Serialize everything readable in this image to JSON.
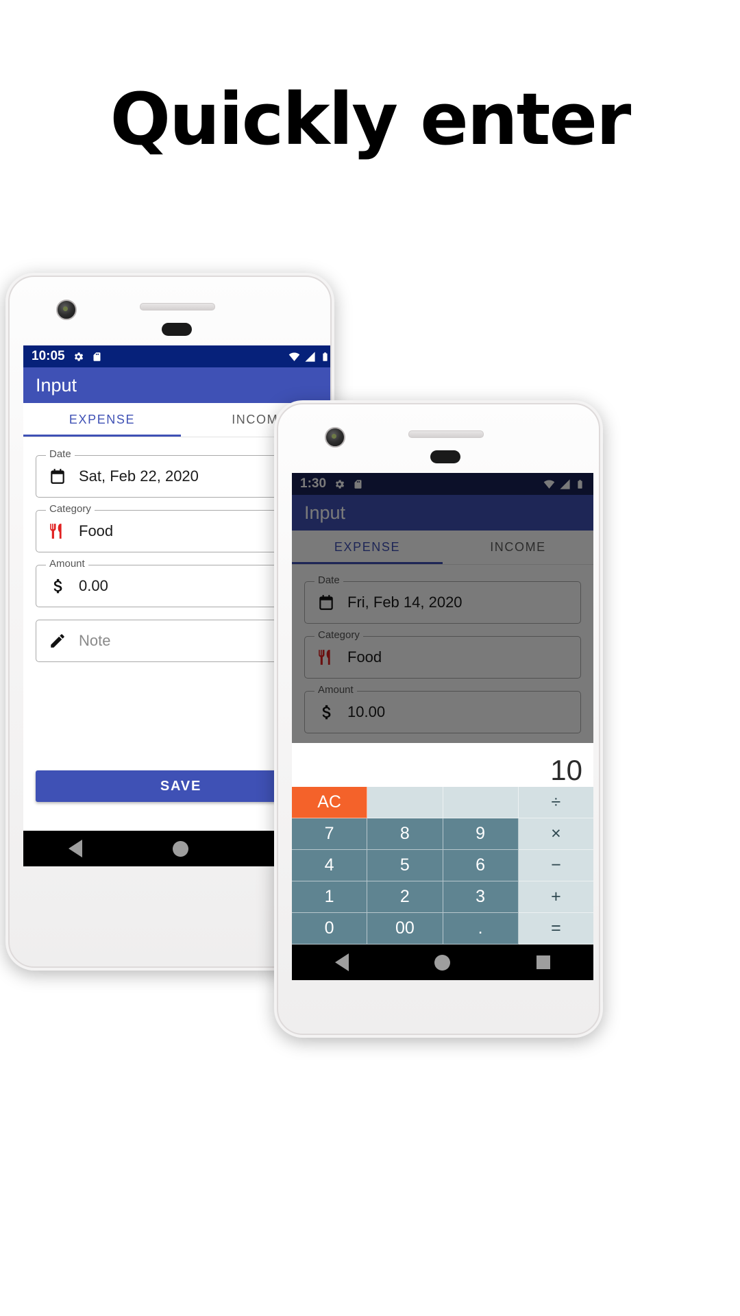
{
  "headline": "Quickly enter",
  "phone1": {
    "statusbar": {
      "time": "10:05",
      "icons": [
        "gear-icon",
        "sdcard-icon"
      ],
      "right_icons": [
        "wifi-icon",
        "signal-icon",
        "battery-icon"
      ]
    },
    "appbar": {
      "title": "Input"
    },
    "tabs": [
      {
        "label": "EXPENSE",
        "active": true
      },
      {
        "label": "INCOME",
        "active": false
      }
    ],
    "fields": [
      {
        "label": "Date",
        "value": "Sat, Feb 22, 2020",
        "icon": "calendar-icon",
        "placeholder": false
      },
      {
        "label": "Category",
        "value": "Food",
        "icon": "restaurant-icon",
        "placeholder": false
      },
      {
        "label": "Amount",
        "value": "0.00",
        "icon": "dollar-icon",
        "placeholder": false
      },
      {
        "label": "",
        "value": "Note",
        "icon": "pencil-icon",
        "placeholder": true
      }
    ],
    "save_label": "SAVE",
    "navbar": [
      "back-icon",
      "home-icon",
      "recents-icon"
    ]
  },
  "phone2": {
    "statusbar": {
      "time": "1:30",
      "icons": [
        "gear-icon",
        "sdcard-icon"
      ],
      "right_icons": [
        "wifi-icon",
        "signal-icon",
        "battery-icon"
      ]
    },
    "appbar": {
      "title": "Input"
    },
    "tabs": [
      {
        "label": "EXPENSE",
        "active": true
      },
      {
        "label": "INCOME",
        "active": false
      }
    ],
    "fields": [
      {
        "label": "Date",
        "value": "Fri, Feb 14, 2020",
        "icon": "calendar-icon",
        "placeholder": false
      },
      {
        "label": "Category",
        "value": "Food",
        "icon": "restaurant-icon",
        "placeholder": false
      },
      {
        "label": "Amount",
        "value": "10.00",
        "icon": "dollar-icon",
        "placeholder": false
      }
    ],
    "calculator": {
      "display": "10",
      "rows": [
        [
          {
            "label": "AC",
            "kind": "ac"
          },
          {
            "label": "",
            "kind": "op"
          },
          {
            "label": "",
            "kind": "op"
          },
          {
            "label": "÷",
            "kind": "op"
          }
        ],
        [
          {
            "label": "7",
            "kind": "num"
          },
          {
            "label": "8",
            "kind": "num"
          },
          {
            "label": "9",
            "kind": "num"
          },
          {
            "label": "×",
            "kind": "op"
          }
        ],
        [
          {
            "label": "4",
            "kind": "num"
          },
          {
            "label": "5",
            "kind": "num"
          },
          {
            "label": "6",
            "kind": "num"
          },
          {
            "label": "−",
            "kind": "op"
          }
        ],
        [
          {
            "label": "1",
            "kind": "num"
          },
          {
            "label": "2",
            "kind": "num"
          },
          {
            "label": "3",
            "kind": "num"
          },
          {
            "label": "+",
            "kind": "op"
          }
        ],
        [
          {
            "label": "0",
            "kind": "num"
          },
          {
            "label": "00",
            "kind": "num"
          },
          {
            "label": ".",
            "kind": "num"
          },
          {
            "label": "=",
            "kind": "op"
          }
        ]
      ]
    },
    "navbar": [
      "back-icon",
      "home-icon",
      "recents-icon"
    ]
  },
  "colors": {
    "primary": "#3f51b5",
    "status_dark": "#06217a",
    "accent_orange": "#f4622a",
    "key_num": "#5f8491",
    "key_op": "#d4e0e3",
    "category_red": "#e02020"
  }
}
